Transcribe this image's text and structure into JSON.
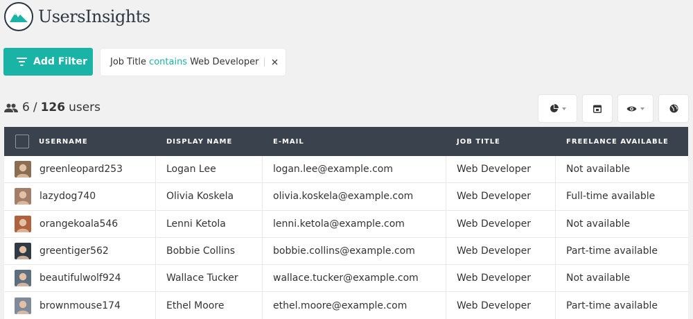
{
  "app": {
    "logo_text": "UsersInsights"
  },
  "toolbar": {
    "add_filter_label": "Add Filter"
  },
  "filter": {
    "field": "Job Title",
    "operator": "contains",
    "value": "Web Developer"
  },
  "summary": {
    "shown": "6",
    "separator": "/",
    "total": "126",
    "unit": "users"
  },
  "tools": [
    {
      "icon": "pie-chart-icon",
      "has_dropdown": true
    },
    {
      "icon": "calendar-icon",
      "has_dropdown": false
    },
    {
      "icon": "eye-icon",
      "has_dropdown": true
    },
    {
      "icon": "globe-icon",
      "has_dropdown": false
    }
  ],
  "table": {
    "columns": [
      "USERNAME",
      "DISPLAY NAME",
      "E-MAIL",
      "JOB TITLE",
      "FREELANCE AVAILABLE"
    ],
    "rows": [
      {
        "username": "greenleopard253",
        "display_name": "Logan Lee",
        "email": "logan.lee@example.com",
        "job_title": "Web Developer",
        "freelance": "Not available",
        "avatar_color": "#8b6d52"
      },
      {
        "username": "lazydog740",
        "display_name": "Olivia Koskela",
        "email": "olivia.koskela@example.com",
        "job_title": "Web Developer",
        "freelance": "Full-time available",
        "avatar_color": "#a37f6b"
      },
      {
        "username": "orangekoala546",
        "display_name": "Lenni Ketola",
        "email": "lenni.ketola@example.com",
        "job_title": "Web Developer",
        "freelance": "Not available",
        "avatar_color": "#b0623f"
      },
      {
        "username": "greentiger562",
        "display_name": "Bobbie Collins",
        "email": "bobbie.collins@example.com",
        "job_title": "Web Developer",
        "freelance": "Part-time available",
        "avatar_color": "#2f3a44"
      },
      {
        "username": "beautifulwolf924",
        "display_name": "Wallace Tucker",
        "email": "wallace.tucker@example.com",
        "job_title": "Web Developer",
        "freelance": "Not available",
        "avatar_color": "#5d6f7e"
      },
      {
        "username": "brownmouse174",
        "display_name": "Ethel Moore",
        "email": "ethel.moore@example.com",
        "job_title": "Web Developer",
        "freelance": "Part-time available",
        "avatar_color": "#7f8b9a"
      }
    ]
  }
}
